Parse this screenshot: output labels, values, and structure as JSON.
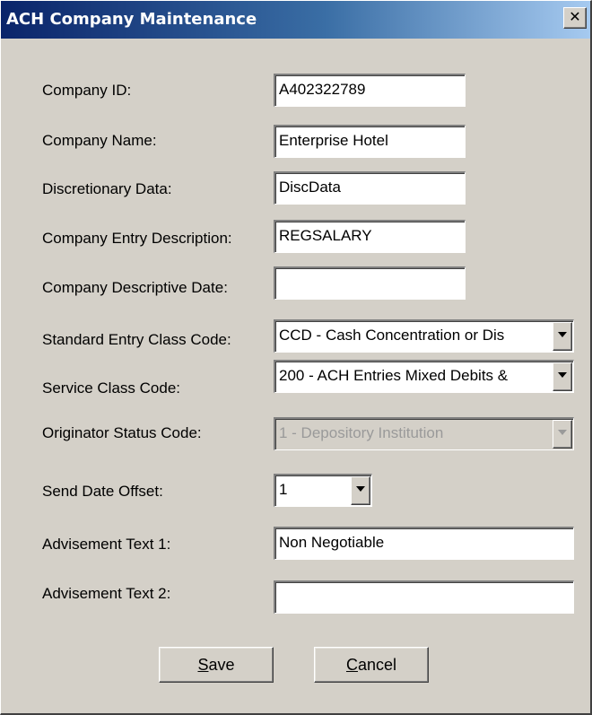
{
  "window": {
    "title": "ACH Company Maintenance",
    "close_glyph": "✕"
  },
  "form": {
    "company_id": {
      "label": "Company ID:",
      "value": "A402322789"
    },
    "company_name": {
      "label": "Company Name:",
      "value": "Enterprise Hotel"
    },
    "discretionary_data": {
      "label": "Discretionary Data:",
      "value": "DiscData"
    },
    "entry_description": {
      "label": "Company Entry Description:",
      "value": "REGSALARY"
    },
    "descriptive_date": {
      "label": "Company Descriptive Date:",
      "value": ""
    },
    "sec_code": {
      "label": "Standard Entry Class Code:",
      "selected": "CCD - Cash Concentration or Dis"
    },
    "service_class_code": {
      "label": "Service Class Code:",
      "selected": "200 - ACH Entries Mixed Debits &"
    },
    "originator_status_code": {
      "label": "Originator Status Code:",
      "selected": "1 - Depository Institution",
      "disabled": true
    },
    "send_date_offset": {
      "label": "Send Date Offset:",
      "selected": "1"
    },
    "advisement_text_1": {
      "label": "Advisement Text 1:",
      "value": "Non Negotiable"
    },
    "advisement_text_2": {
      "label": "Advisement Text 2:",
      "value": ""
    }
  },
  "buttons": {
    "save": {
      "mnemonic": "S",
      "rest": "ave"
    },
    "cancel": {
      "mnemonic": "C",
      "rest": "ancel"
    }
  },
  "colors": {
    "title_gradient_start": "#0a246a",
    "title_gradient_end": "#a6caf0",
    "dialog_face": "#d4d0c8",
    "disabled_text": "#9a9a9a"
  },
  "icons": {
    "close": "close-icon",
    "dropdown": "chevron-down-icon"
  }
}
